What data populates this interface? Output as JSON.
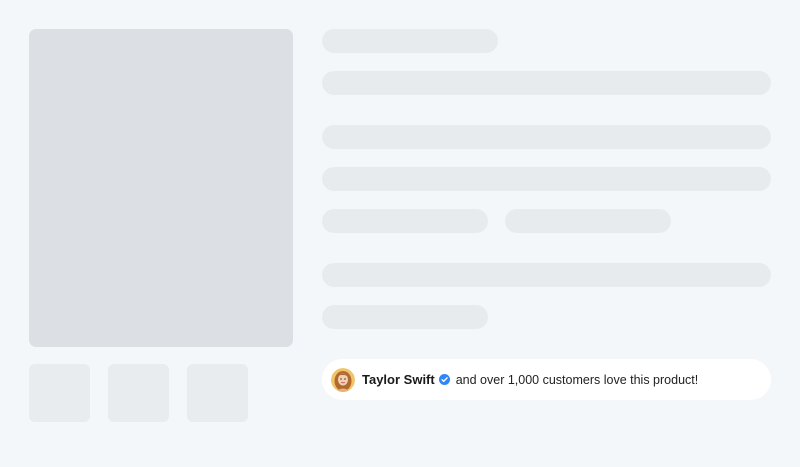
{
  "product": {
    "image_placeholder": "main-product-image",
    "thumbnails": 3
  },
  "social_proof": {
    "name": "Taylor Swift",
    "verified": true,
    "verified_color": "#2f86f6",
    "text": "and over 1,000 customers love this product!",
    "avatar_icon": "avatar-icon",
    "badge_icon": "verified-badge-icon"
  },
  "colors": {
    "background": "#f4f7fa",
    "skeleton_dark": "#dcdfe3",
    "skeleton_light": "#e8ebee"
  }
}
